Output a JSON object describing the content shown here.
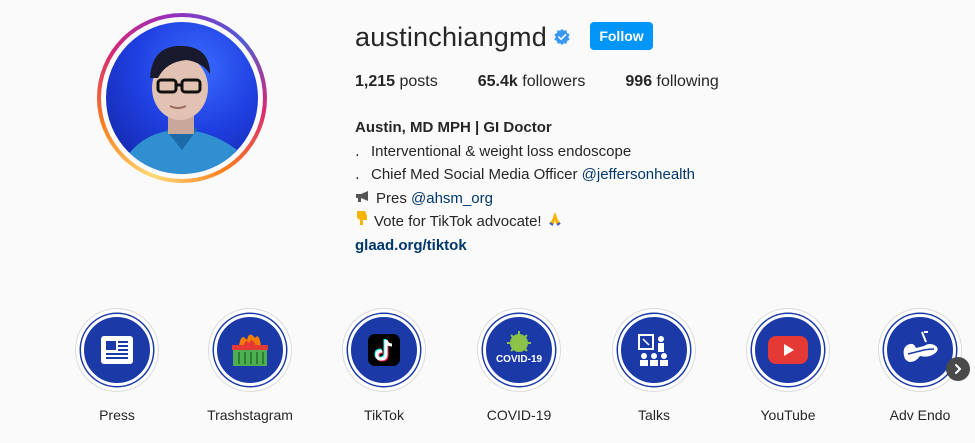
{
  "profile": {
    "username": "austinchiangmd",
    "follow_label": "Follow",
    "stats": {
      "posts_count": "1,215",
      "posts_label": "posts",
      "followers_count": "65.4k",
      "followers_label": "followers",
      "following_count": "996",
      "following_label": "following"
    },
    "bio": {
      "name": "Austin, MD MPH | GI Doctor",
      "line1": "Interventional & weight loss endoscope",
      "line2_text": "Chief Med Social Media Officer ",
      "line2_mention": "@jeffersonhealth",
      "line3_text": "Pres ",
      "line3_mention": "@ahsm_org",
      "line4_text": "Vote for TikTok advocate!",
      "link": "glaad.org/tiktok"
    }
  },
  "highlights": [
    {
      "label": "Press",
      "icon": "newspaper-icon"
    },
    {
      "label": "Trashstagram",
      "icon": "dumpster-fire-icon"
    },
    {
      "label": "TikTok",
      "icon": "tiktok-icon"
    },
    {
      "label": "COVID-19",
      "icon": "covid-icon"
    },
    {
      "label": "Talks",
      "icon": "presentation-icon"
    },
    {
      "label": "YouTube",
      "icon": "youtube-icon"
    },
    {
      "label": "Adv Endo",
      "icon": "pancreas-icon"
    }
  ],
  "colors": {
    "accent": "#0095f6",
    "link": "#00376b",
    "highlight_bg": "#1b3aa8",
    "verified": "#3897f0"
  }
}
